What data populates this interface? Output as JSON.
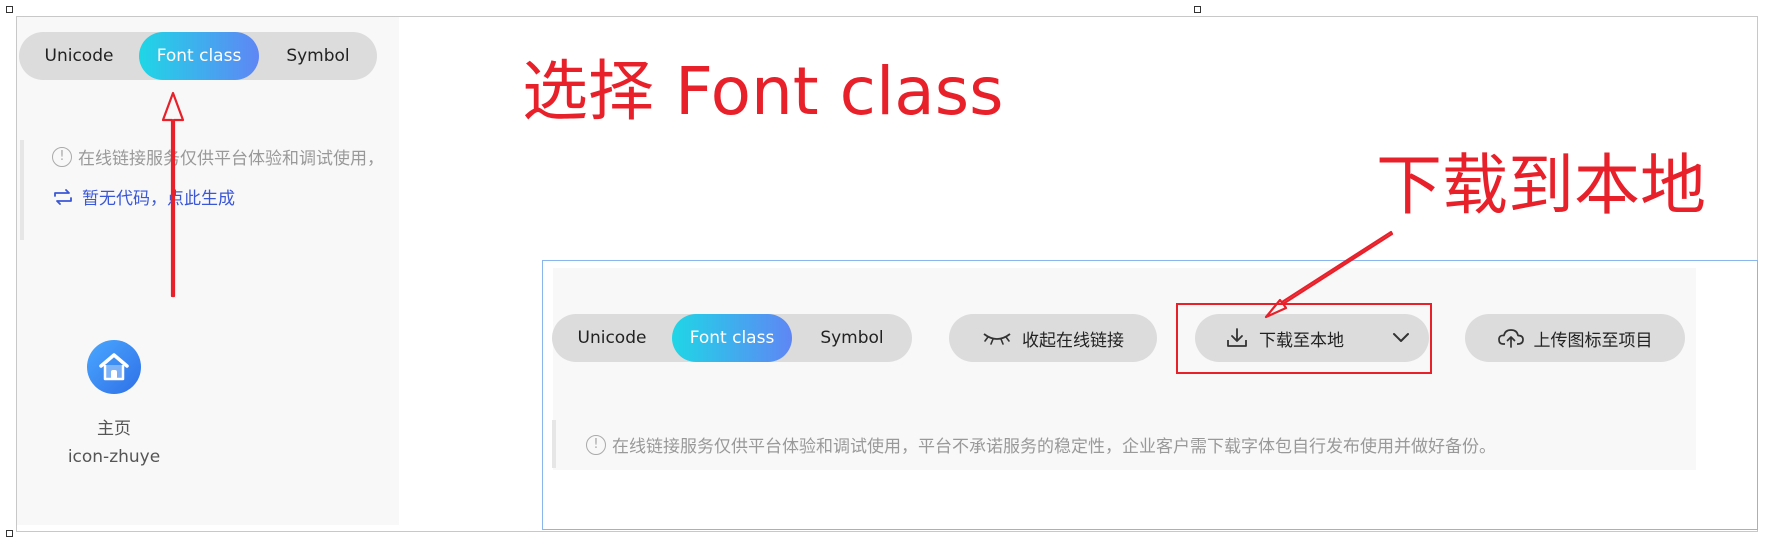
{
  "segmented": {
    "options": [
      "Unicode",
      "Font class",
      "Symbol"
    ],
    "selected": "Font class"
  },
  "left_panel": {
    "notice": "在线链接服务仅供平台体验和调试使用，",
    "notice_icon": "info-icon",
    "link": "暂无代码，点此生成",
    "link_icon": "refresh-icon",
    "icon_card": {
      "glyph": "home-icon",
      "name": "主页",
      "code": "icon-zhuye",
      "color": "#2f6fe8"
    }
  },
  "annotations": {
    "select_font_class": "选择 Font class",
    "download_local": "下载到本地",
    "color": "#e8202a"
  },
  "toolbar": {
    "collapse_label": "收起在线链接",
    "collapse_icon": "eye-closed-icon",
    "download_label": "下载至本地",
    "download_icon": "download-icon",
    "dropdown_icon": "chevron-down-icon",
    "upload_label": "上传图标至项目",
    "upload_icon": "cloud-upload-icon"
  },
  "right_panel": {
    "notice": "在线链接服务仅供平台体验和调试使用，平台不承诺服务的稳定性，企业客户需下载字体包自行发布使用并做好备份。"
  }
}
